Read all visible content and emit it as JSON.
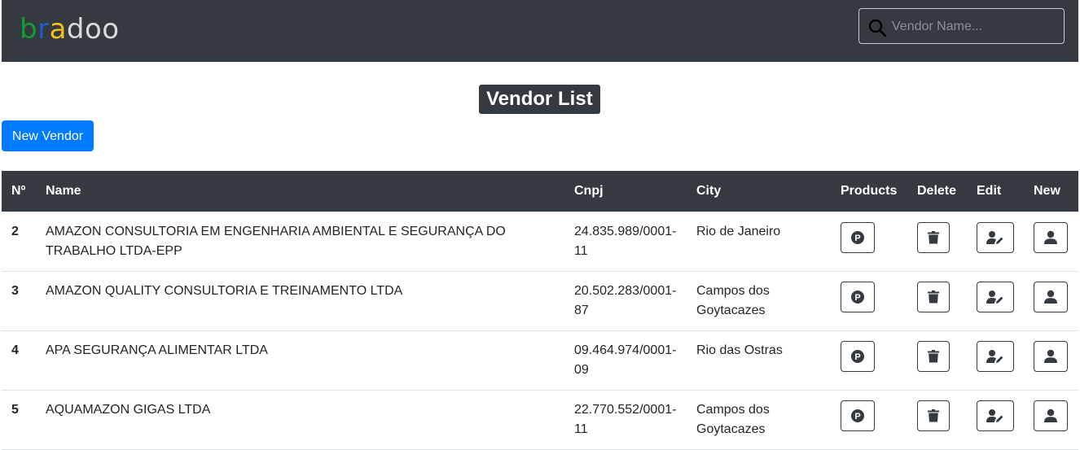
{
  "header": {
    "logo": {
      "b": "b",
      "r": "r",
      "a": "a",
      "doo": "doo"
    },
    "search_placeholder": "Vendor Name..."
  },
  "page_title": "Vendor List",
  "new_vendor_label": "New Vendor",
  "table": {
    "columns": [
      "Nº",
      "Name",
      "Cnpj",
      "City",
      "Products",
      "Delete",
      "Edit",
      "New"
    ],
    "rows": [
      {
        "num": "2",
        "name": "AMAZON CONSULTORIA EM ENGENHARIA AMBIENTAL E SEGURANÇA DO TRABALHO LTDA-EPP",
        "cnpj": "24.835.989/0001-11",
        "city": "Rio de Janeiro"
      },
      {
        "num": "3",
        "name": "AMAZON QUALITY CONSULTORIA E TREINAMENTO LTDA",
        "cnpj": "20.502.283/0001-87",
        "city": "Campos dos Goytacazes"
      },
      {
        "num": "4",
        "name": "APA SEGURANÇA ALIMENTAR LTDA",
        "cnpj": "09.464.974/0001-09",
        "city": "Rio das Ostras"
      },
      {
        "num": "5",
        "name": "AQUAMAZON GIGAS LTDA",
        "cnpj": "22.770.552/0001-11",
        "city": "Campos dos Goytacazes"
      }
    ]
  },
  "icons": {
    "products": "product-p-icon",
    "delete": "trash-icon",
    "edit": "user-edit-icon",
    "new": "user-icon"
  },
  "colors": {
    "navbar": "#343a40",
    "primary": "#007bff",
    "logo_green": "#159a3a",
    "logo_blue": "#1c5fcc",
    "logo_yellow": "#f2c21b"
  }
}
